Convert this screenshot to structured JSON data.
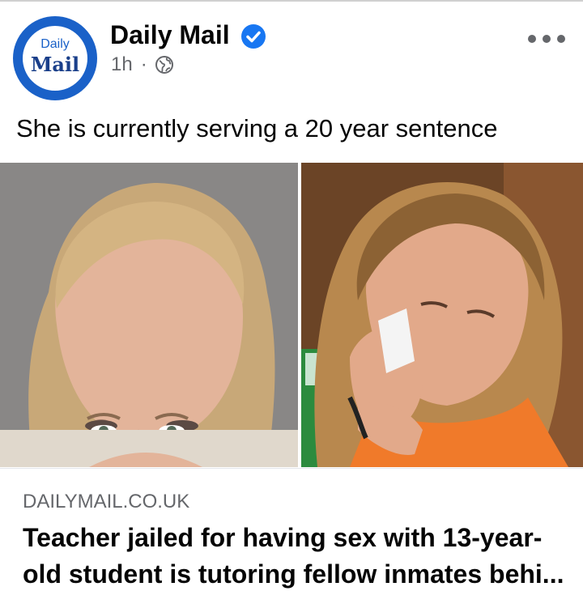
{
  "post": {
    "page_name": "Daily Mail",
    "avatar_text_top": "Daily",
    "avatar_text_bottom": "Mail",
    "timestamp": "1h",
    "separator": "·",
    "visibility_icon": "globe-icon",
    "verified_icon": "verified-badge-icon",
    "more_icon": "more-options-icon",
    "caption": "She is currently serving a 20 year sentence"
  },
  "link_preview": {
    "domain": "DAILYMAIL.CO.UK",
    "headline_line1": "Teacher jailed for having sex with 13-year-",
    "headline_line2": "old student is tutoring fellow inmates behi..."
  },
  "colors": {
    "brand_blue": "#1a61c8",
    "verified_blue": "#1877f2",
    "text_primary": "#050505",
    "text_secondary": "#65676b",
    "jumpsuit_orange": "#f07a2a"
  }
}
